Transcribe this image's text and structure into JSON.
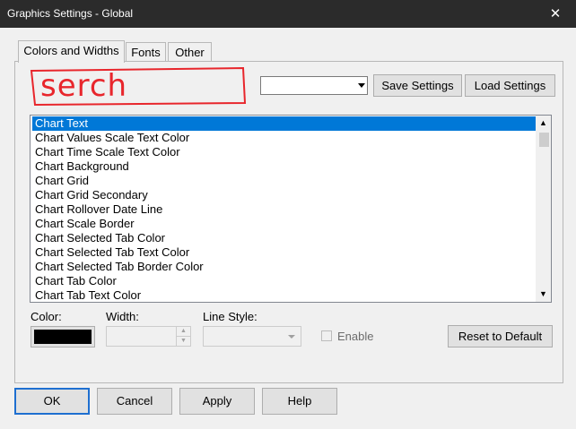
{
  "window": {
    "title": "Graphics Settings - Global",
    "close_glyph": "✕"
  },
  "tabs": [
    {
      "label": "Colors and Widths",
      "active": true
    },
    {
      "label": "Fonts",
      "active": false
    },
    {
      "label": "Other",
      "active": false
    }
  ],
  "annotation": {
    "text": "serch",
    "color": "#e8262c"
  },
  "settings_combo": {
    "value": ""
  },
  "buttons": {
    "save_settings": "Save Settings",
    "load_settings": "Load Settings",
    "reset_to_default": "Reset to Default",
    "ok": "OK",
    "cancel": "Cancel",
    "apply": "Apply",
    "help": "Help"
  },
  "chart_items": [
    "Chart Text",
    "Chart Values Scale Text Color",
    "Chart Time Scale Text Color",
    "Chart Background",
    "Chart Grid",
    "Chart Grid Secondary",
    "Chart Rollover Date Line",
    "Chart Scale Border",
    "Chart Selected Tab Color",
    "Chart Selected Tab Text Color",
    "Chart Selected Tab Border Color",
    "Chart Tab Color",
    "Chart Tab Text Color"
  ],
  "selected_item_index": 0,
  "fields": {
    "color_label": "Color:",
    "width_label": "Width:",
    "line_style_label": "Line Style:",
    "enable_label": "Enable",
    "color_value": "#000000",
    "width_value": "",
    "line_style_value": "",
    "enable_checked": false
  },
  "colors": {
    "selection": "#0078d7",
    "titlebar": "#2b2b2b",
    "default_button_border": "#1e6fd0"
  }
}
